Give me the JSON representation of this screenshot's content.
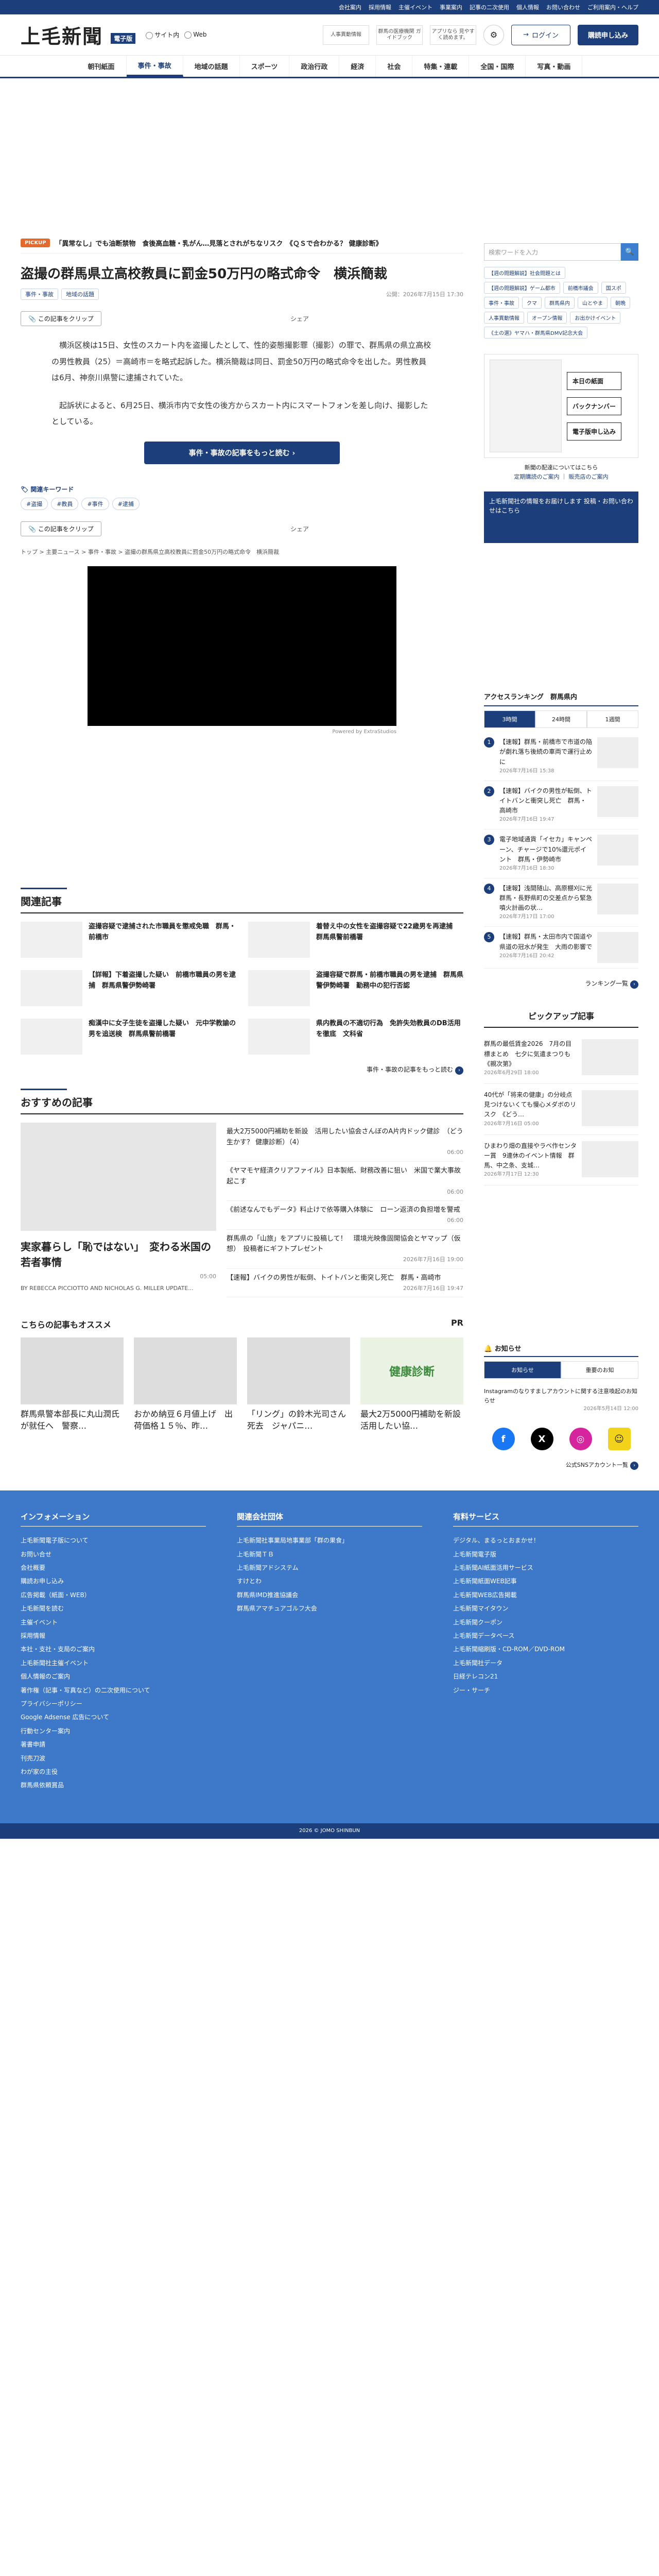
{
  "topbar": {
    "links": [
      "会社案内",
      "採用情報",
      "主催イベント",
      "事業案内",
      "記事の二次使用",
      "個人情報",
      "お問い合わせ",
      "ご利用案内・ヘルプ"
    ]
  },
  "header": {
    "logo": "上毛新聞",
    "logo_tag": "電子版",
    "radio_site": "サイト内",
    "radio_web": "Web",
    "ad1": "人事異動情報",
    "ad2": "群馬の医療機関 ガイドブック",
    "ad3": "アプリなら 見やすく読めます。",
    "login": "ログイン",
    "subscribe": "購読申し込み"
  },
  "nav": [
    "朝刊紙面",
    "事件・事故",
    "地域の話題",
    "スポーツ",
    "政治行政",
    "経済",
    "社会",
    "特集・連載",
    "全国・国際",
    "写真・動画"
  ],
  "pickup": {
    "badge": "PICKUP",
    "text": "「異常なし」でも油断禁物　食後高血糖・乳がん…見落とされがちなリスク　《ＱＳで合わかる？ 健康診断》"
  },
  "article": {
    "title": "盗撮の群馬県立高校教員に罰金50万円の略式命令　横浜簡裁",
    "tags": [
      "事件・事故",
      "地域の話題"
    ],
    "time": "公開：2026年7月15日 17:30",
    "clip": "この記事をクリップ",
    "share": "シェア",
    "paragraphs": [
      "横浜区検は15日、女性のスカート内を盗撮したとして、性的姿態撮影罪（撮影）の罪で、群馬県の県立高校の男性教員（25）＝高崎市＝を略式起訴した。横浜簡裁は同日、罰金50万円の略式命令を出した。男性教員は6月、神奈川県警に逮捕されていた。",
      "起訴状によると、6月25日、横浜市内で女性の後方からスカート内にスマートフォンを差し向け、撮影したとしている。"
    ],
    "more_btn": "事件・事故の記事をもっと読む",
    "keyword_title": "関連キーワード",
    "keywords": [
      "#盗撮",
      "#教員",
      "#事件",
      "#逮捕"
    ],
    "crumbs": "トップ > 主要ニュース > 事件・事故 > 盗撮の群馬県立高校教員に罰金50万円の略式命令　横浜簡裁",
    "video_caption": "Powered by ExtraStudios"
  },
  "related": {
    "title": "関連記事",
    "items": [
      "盗撮容疑で逮捕された市職員を懲戒免職　群馬・前橋市",
      "着替え中の女性を盗撮容疑で22歳男を再逮捕　群馬県警前橋署",
      "【詳報】下着盗撮した疑い　前橋市職員の男を逮捕　群馬県警伊勢崎署",
      "盗撮容疑で群馬・前橋市職員の男を逮捕　群馬県警伊勢崎署　勤務中の犯行否認",
      "痴漢中に女子生徒を盗撮した疑い　元中学教諭の男を追送検　群馬県警前橋署",
      "県内教員の不適切行為　免許失効教員のDB活用を徹底　文科省"
    ],
    "more": "事件・事故の記事をもっと読む"
  },
  "recommend": {
    "title": "おすすめの記事",
    "big_title": "実家暮らし「恥ではない」　変わる米国の若者事情",
    "big_date": "05:00",
    "big_author": "BY REBECCA PICCIOTTO AND NICHOLAS G. MILLER UPDATE...",
    "items": [
      {
        "t": "最大2万5000円補助を新設　活用したい協会さんぼのA片内ドック健診　（どう生かす？ 健康診断）（4）",
        "d": "06:00"
      },
      {
        "t": "《ヤマモヤ経済クリアファイル》日本製紙、財務改善に狙い　米国で業大事故起こす",
        "d": "06:00"
      },
      {
        "t": "《前述なんでもデータ》料止けで依等購入体験に　ローン返済の負担増を警戒",
        "d": "06:00"
      },
      {
        "t": "群馬県の「山旅」をアプリに投稿して！　環境光映像固開協会とヤマップ（仮想）　投稿者にギフトプレゼント",
        "d": "2026年7月16日 19:00"
      },
      {
        "t": "【速報】バイクの男性が転倒、トイトバンと衝突し死亡　群馬・高崎市",
        "d": "2026年7月16日 19:47"
      }
    ]
  },
  "osusume": {
    "title": "こちらの記事もオススメ",
    "pr": "PR",
    "items": [
      "群馬県警本部長に丸山潤氏が就任へ　警察…",
      "おかめ納豆６月値上げ　出荷価格１５％、昨…",
      "「リング」の鈴木光司さん死去　ジャパニ…",
      "最大2万5000円補助を新設　活用したい協…"
    ],
    "img_labels": [
      "",
      "",
      "",
      "健康診断"
    ]
  },
  "sidebar": {
    "search_placeholder": "検索ワードを入力",
    "tags": [
      "【週の問題解説】社会問題とは",
      "【週の問題解説】ゲーム都市",
      "前橋市議会",
      "国スポ",
      "事件・事故",
      "クマ",
      "群馬県内",
      "山とやま",
      "朝晩",
      "人事異動情報",
      "オープン情報",
      "お出かけイベント",
      "《土の選》ヤマハ・群馬県DMV記念大会"
    ],
    "paper_btns": [
      "本日の紙面",
      "バックナンバー",
      "電子版申し込み"
    ],
    "note_title": "新聞の配達についてはこちら",
    "note_link": "定期購読のご案内 ｜ 販売店のご案内",
    "ad_text": "上毛新聞社の情報をお届けします 投稿・お問い合わせはこちら"
  },
  "ranking": {
    "title": "アクセスランキング　群馬県内",
    "tabs": [
      "3時間",
      "24時間",
      "1週間"
    ],
    "items": [
      {
        "t": "【速報】群馬・前橋市で市道の陥が劇れ落ち後続の車両で運行止めに",
        "d": "2026年7月16日 15:38"
      },
      {
        "t": "【速報】バイクの男性が転倒、トイトバンと衝突し死亡　群馬・高崎市",
        "d": "2026年7月16日 19:47"
      },
      {
        "t": "電子地域通貨「イセカ」キャンペーン、チャージで10%還元ポイント　群馬・伊勢崎市",
        "d": "2026年7月16日 18:30"
      },
      {
        "t": "【速報】浅間隧山、高原棚刈に光　群馬・長野県町の交差点から緊急噴火計画の状…",
        "d": "2026年7月17日 17:00"
      },
      {
        "t": "【速報】群馬・太田市内で国道や県道の冠水が発生　大雨の影響で",
        "d": "2026年7月16日 20:42"
      }
    ],
    "more": "ランキング一覧"
  },
  "pickup_side": {
    "title": "ピックアップ記事",
    "items": [
      {
        "t": "群馬の最低賃金2026　7月の目標まとめ　七夕に気遣まつりも　《親次第》",
        "d": "2026年6月29日 18:00"
      },
      {
        "t": "40代が「将来の健康」の分岐点　見つけないくても慢心メダボのリスク　《どう…",
        "d": "2026年7月16日 05:00"
      },
      {
        "t": "ひまわり畑の直接やラベ作センター賞　9連休のイベント情報　群馬、中之条、支城…",
        "d": "2026年7月17日 12:30"
      }
    ]
  },
  "notice": {
    "title": "お知らせ",
    "tabs": [
      "お知らせ",
      "重要のお知",
      "",
      "",
      ""
    ],
    "body": "Instagramのなりすましアカウントに関する注意喚起のお知らせ",
    "date": "2026年5月14日 12:00",
    "sns_more": "公式SNSアカウント一覧"
  },
  "footer": {
    "cols": [
      {
        "h": "インフォメーション",
        "links": [
          "上毛新聞電子版について",
          "お問い合せ",
          "会社概要",
          "購読お申し込み",
          "広告掲載（紙面・WEB）",
          "上毛新聞を読む",
          "主催イベント",
          "採用情報",
          "本社・支社・支局のご案内",
          "上毛新聞社主催イベント",
          "個人情報のご案内",
          "著作権（記事・写真など）の二次使用について",
          "プライバシーポリシー",
          "Google Adsense 広告について",
          "行動センター案内",
          "著書申請",
          "刊売刀波",
          "わが家の主役",
          "群馬県依頼賞品"
        ]
      },
      {
        "h": "関連会社団体",
        "links": [
          "上毛新聞社事業局地事業部「群の果食」",
          "上毛新聞ＴＢ",
          "上毛新聞アドシステム",
          "すけとわ",
          "群馬県IMD推進協議会",
          "群馬県アマチュアゴルフ大会"
        ]
      },
      {
        "h": "有料サービス",
        "links": [
          "デジタル、まるっとおまかせ！",
          "上毛新聞電子版",
          "上毛新聞AI紙面活用サービス",
          "上毛新聞紙面WEB記事",
          "上毛新聞WEB広告掲載",
          "上毛新聞マイタウン",
          "上毛新聞クーポン",
          "上毛新聞データベース",
          "上毛新聞縮刷版・CD-ROM／DVD-ROM",
          "上毛新聞社データ",
          "日経テレコン21",
          "ジー・サーチ"
        ]
      }
    ],
    "copyright": "2026 © JOMO SHINBUN"
  },
  "colors": {
    "brand": "#1c3e7a",
    "accent": "#3e78c8",
    "pickup": "#e26a2c"
  }
}
